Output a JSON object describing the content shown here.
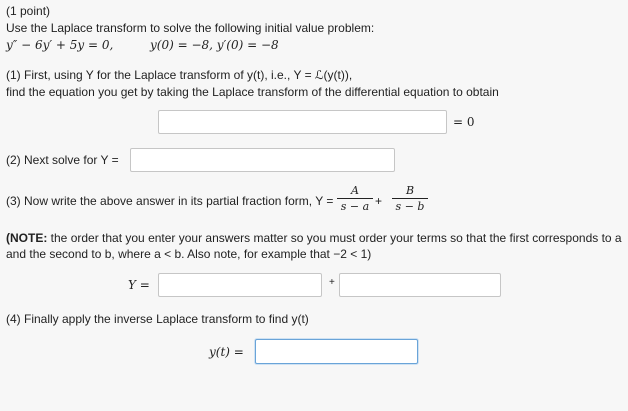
{
  "header": {
    "points": "(1 point)",
    "instruction": "Use the Laplace transform to solve the following initial value problem:",
    "equation": "y″ − 6y′ + 5y = 0,",
    "initial_conditions": "y(0) = −8,  y′(0) = −8"
  },
  "step1": {
    "line1": "(1) First, using Y for the Laplace transform of y(t), i.e., Y = ℒ(y(t)),",
    "line2": "find the equation you get by taking the Laplace transform of the differential equation to obtain",
    "input_value": "",
    "suffix": "= 0"
  },
  "step2": {
    "label": "(2) Next solve for Y =",
    "input_value": ""
  },
  "step3": {
    "label": "(3) Now write the above answer in its partial fraction form, Y =",
    "frac1_num": "A",
    "frac1_den": "s − a",
    "plus": "+",
    "frac2_num": "B",
    "frac2_den": "s − b"
  },
  "note": {
    "bold_label": "(NOTE:",
    "line1": "the order that you enter your answers matter so you must order your terms so that the first corresponds to a",
    "line2": "and the second to b, where a < b. Also note, for example that −2 < 1)"
  },
  "partial_inputs": {
    "label": "Y =",
    "input1_value": "",
    "plus": "+",
    "input2_value": ""
  },
  "step4": {
    "label": "(4) Finally apply the inverse Laplace transform to find y(t)",
    "y_label": "y(t) =",
    "input_value": ""
  }
}
